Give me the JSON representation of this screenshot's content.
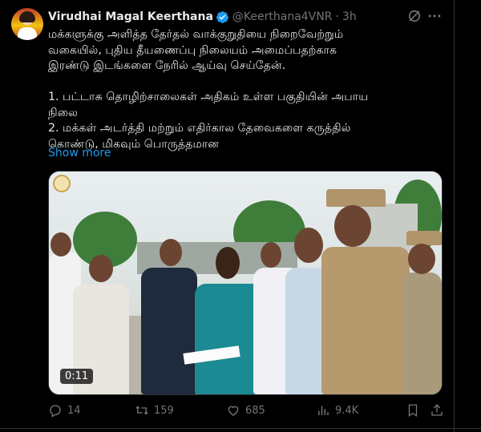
{
  "tweet": {
    "author_name": "Virudhai Magal Keerthana",
    "handle": "@Keerthana4VNR",
    "separator": "·",
    "time": "3h",
    "lines": [
      "மக்களுக்கு அளித்த தேர்தல் வாக்குறுதியை நிறைவேற்றும்",
      "வகையில், புதிய தீயணைப்பு நிலையம் அமைப்பதற்காக",
      "இரண்டு இடங்களை நேரில் ஆய்வு செய்தேன்.",
      "",
      "1. பட்டாசு தொழிற்சாலைகள் அதிகம் உள்ள பகுதியின் அபாய",
      "நிலை",
      "2. மக்கள் அடர்த்தி மற்றும் எதிர்கால தேவைகளை கருத்தில்",
      "கொண்டு, மிகவும் பொருத்தமான"
    ],
    "show_more": "Show more",
    "video_duration": "0:11"
  },
  "actions": {
    "replies": "14",
    "retweets": "159",
    "likes": "685",
    "views": "9.4K"
  },
  "icons": [
    "verified-icon",
    "grok-icon",
    "more-icon",
    "reply-icon",
    "retweet-icon",
    "like-icon",
    "views-icon",
    "bookmark-icon",
    "share-icon"
  ],
  "colors": {
    "accent": "#1d9bf0",
    "muted": "#71767b",
    "text": "#e7e9ea",
    "background": "#000000"
  }
}
